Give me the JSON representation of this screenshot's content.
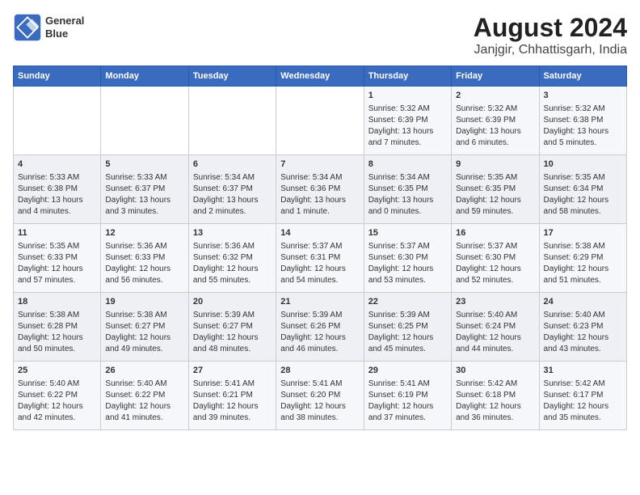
{
  "header": {
    "logo_line1": "General",
    "logo_line2": "Blue",
    "title": "August 2024",
    "subtitle": "Janjgir, Chhattisgarh, India"
  },
  "days_of_week": [
    "Sunday",
    "Monday",
    "Tuesday",
    "Wednesday",
    "Thursday",
    "Friday",
    "Saturday"
  ],
  "weeks": [
    [
      {
        "day": "",
        "content": ""
      },
      {
        "day": "",
        "content": ""
      },
      {
        "day": "",
        "content": ""
      },
      {
        "day": "",
        "content": ""
      },
      {
        "day": "1",
        "content": "Sunrise: 5:32 AM\nSunset: 6:39 PM\nDaylight: 13 hours and 7 minutes."
      },
      {
        "day": "2",
        "content": "Sunrise: 5:32 AM\nSunset: 6:39 PM\nDaylight: 13 hours and 6 minutes."
      },
      {
        "day": "3",
        "content": "Sunrise: 5:32 AM\nSunset: 6:38 PM\nDaylight: 13 hours and 5 minutes."
      }
    ],
    [
      {
        "day": "4",
        "content": "Sunrise: 5:33 AM\nSunset: 6:38 PM\nDaylight: 13 hours and 4 minutes."
      },
      {
        "day": "5",
        "content": "Sunrise: 5:33 AM\nSunset: 6:37 PM\nDaylight: 13 hours and 3 minutes."
      },
      {
        "day": "6",
        "content": "Sunrise: 5:34 AM\nSunset: 6:37 PM\nDaylight: 13 hours and 2 minutes."
      },
      {
        "day": "7",
        "content": "Sunrise: 5:34 AM\nSunset: 6:36 PM\nDaylight: 13 hours and 1 minute."
      },
      {
        "day": "8",
        "content": "Sunrise: 5:34 AM\nSunset: 6:35 PM\nDaylight: 13 hours and 0 minutes."
      },
      {
        "day": "9",
        "content": "Sunrise: 5:35 AM\nSunset: 6:35 PM\nDaylight: 12 hours and 59 minutes."
      },
      {
        "day": "10",
        "content": "Sunrise: 5:35 AM\nSunset: 6:34 PM\nDaylight: 12 hours and 58 minutes."
      }
    ],
    [
      {
        "day": "11",
        "content": "Sunrise: 5:35 AM\nSunset: 6:33 PM\nDaylight: 12 hours and 57 minutes."
      },
      {
        "day": "12",
        "content": "Sunrise: 5:36 AM\nSunset: 6:33 PM\nDaylight: 12 hours and 56 minutes."
      },
      {
        "day": "13",
        "content": "Sunrise: 5:36 AM\nSunset: 6:32 PM\nDaylight: 12 hours and 55 minutes."
      },
      {
        "day": "14",
        "content": "Sunrise: 5:37 AM\nSunset: 6:31 PM\nDaylight: 12 hours and 54 minutes."
      },
      {
        "day": "15",
        "content": "Sunrise: 5:37 AM\nSunset: 6:30 PM\nDaylight: 12 hours and 53 minutes."
      },
      {
        "day": "16",
        "content": "Sunrise: 5:37 AM\nSunset: 6:30 PM\nDaylight: 12 hours and 52 minutes."
      },
      {
        "day": "17",
        "content": "Sunrise: 5:38 AM\nSunset: 6:29 PM\nDaylight: 12 hours and 51 minutes."
      }
    ],
    [
      {
        "day": "18",
        "content": "Sunrise: 5:38 AM\nSunset: 6:28 PM\nDaylight: 12 hours and 50 minutes."
      },
      {
        "day": "19",
        "content": "Sunrise: 5:38 AM\nSunset: 6:27 PM\nDaylight: 12 hours and 49 minutes."
      },
      {
        "day": "20",
        "content": "Sunrise: 5:39 AM\nSunset: 6:27 PM\nDaylight: 12 hours and 48 minutes."
      },
      {
        "day": "21",
        "content": "Sunrise: 5:39 AM\nSunset: 6:26 PM\nDaylight: 12 hours and 46 minutes."
      },
      {
        "day": "22",
        "content": "Sunrise: 5:39 AM\nSunset: 6:25 PM\nDaylight: 12 hours and 45 minutes."
      },
      {
        "day": "23",
        "content": "Sunrise: 5:40 AM\nSunset: 6:24 PM\nDaylight: 12 hours and 44 minutes."
      },
      {
        "day": "24",
        "content": "Sunrise: 5:40 AM\nSunset: 6:23 PM\nDaylight: 12 hours and 43 minutes."
      }
    ],
    [
      {
        "day": "25",
        "content": "Sunrise: 5:40 AM\nSunset: 6:22 PM\nDaylight: 12 hours and 42 minutes."
      },
      {
        "day": "26",
        "content": "Sunrise: 5:40 AM\nSunset: 6:22 PM\nDaylight: 12 hours and 41 minutes."
      },
      {
        "day": "27",
        "content": "Sunrise: 5:41 AM\nSunset: 6:21 PM\nDaylight: 12 hours and 39 minutes."
      },
      {
        "day": "28",
        "content": "Sunrise: 5:41 AM\nSunset: 6:20 PM\nDaylight: 12 hours and 38 minutes."
      },
      {
        "day": "29",
        "content": "Sunrise: 5:41 AM\nSunset: 6:19 PM\nDaylight: 12 hours and 37 minutes."
      },
      {
        "day": "30",
        "content": "Sunrise: 5:42 AM\nSunset: 6:18 PM\nDaylight: 12 hours and 36 minutes."
      },
      {
        "day": "31",
        "content": "Sunrise: 5:42 AM\nSunset: 6:17 PM\nDaylight: 12 hours and 35 minutes."
      }
    ]
  ]
}
